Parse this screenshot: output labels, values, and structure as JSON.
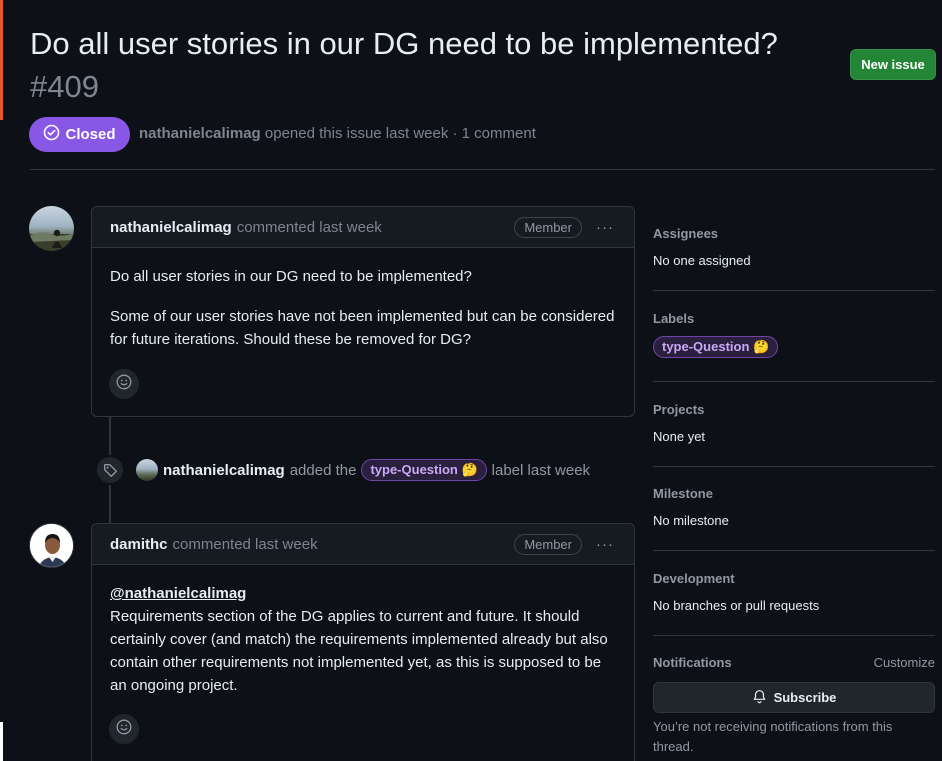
{
  "issue": {
    "title": "Do all user stories in our DG need to be implemented?",
    "number": "#409",
    "state": "Closed",
    "author": "nathanielcalimag",
    "meta_text": "opened this issue last week · 1 comment",
    "new_issue_label": "New issue"
  },
  "comments": [
    {
      "author": "nathanielcalimag",
      "time": "commented last week",
      "role": "Member",
      "menu": "···",
      "paragraphs": [
        "Do all user stories in our DG need to be implemented?",
        "Some of our user stories have not been implemented but can be considered for future iterations. Should these be removed for DG?"
      ]
    },
    {
      "author": "damithc",
      "time": "commented last week",
      "role": "Member",
      "menu": "···",
      "mention": "@nathanielcalimag",
      "text": "Requirements section of the DG applies to current and future. It should certainly cover (and match) the requirements implemented already but also contain other requirements not implemented yet, as this is supposed to be an ongoing project."
    }
  ],
  "event": {
    "author": "nathanielcalimag",
    "action": "added the",
    "label": "type-Question 🤔",
    "suffix": "label last week"
  },
  "sidebar": {
    "assignees": {
      "title": "Assignees",
      "value": "No one assigned"
    },
    "labels": {
      "title": "Labels",
      "label": "type-Question 🤔"
    },
    "projects": {
      "title": "Projects",
      "value": "None yet"
    },
    "milestone": {
      "title": "Milestone",
      "value": "No milestone"
    },
    "development": {
      "title": "Development",
      "value": "No branches or pull requests"
    },
    "notifications": {
      "title": "Notifications",
      "customize": "Customize",
      "subscribe": "Subscribe",
      "text": "You’re not receiving notifications from this thread."
    }
  },
  "colors": {
    "background": "#0d1117",
    "closed": "#8957e5",
    "new_issue": "#238636",
    "label_text": "#c8a8f5"
  }
}
